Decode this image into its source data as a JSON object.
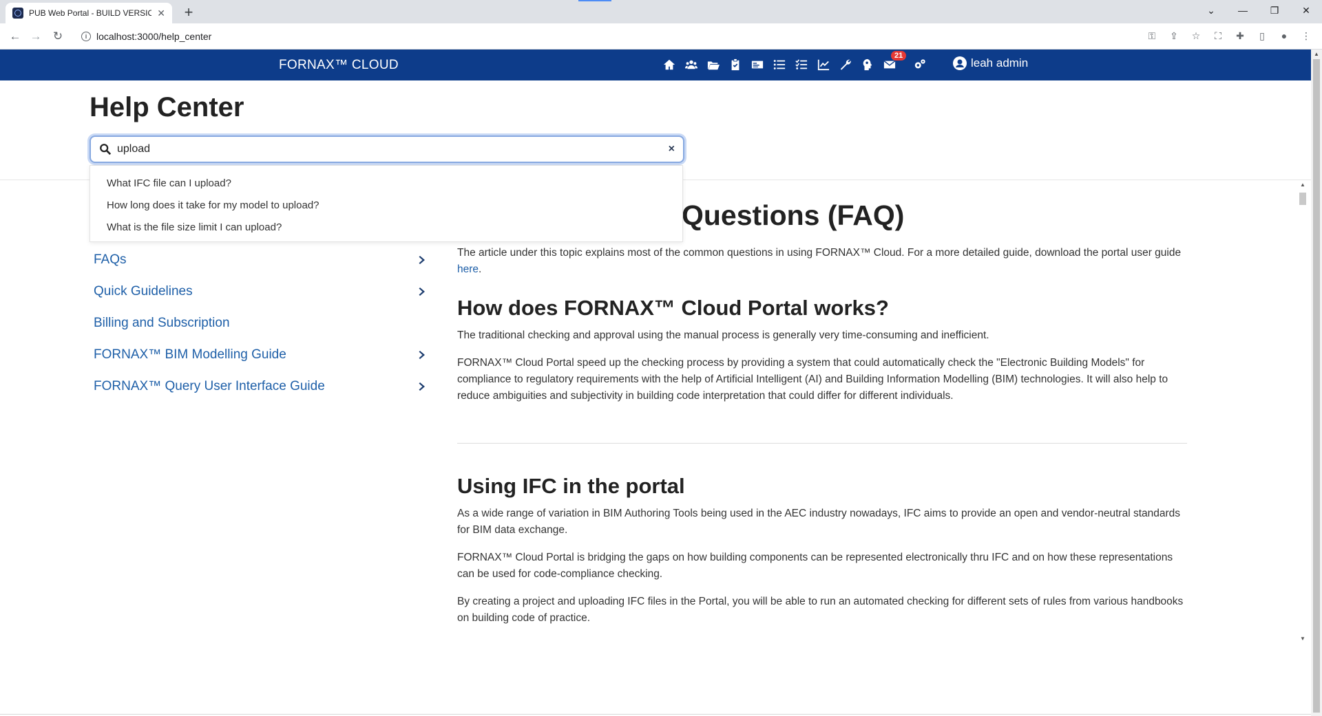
{
  "browser": {
    "tab_title": "PUB Web Portal - BUILD VERSION",
    "new_tab": "+",
    "url": "localhost:3000/help_center"
  },
  "app": {
    "brand": "FORNAX™ CLOUD",
    "notification_count": "21",
    "user_name": "leah admin"
  },
  "help": {
    "title": "Help Center",
    "search": {
      "value": "upload",
      "clear": "×"
    },
    "suggestions": [
      "What IFC file can I upload?",
      "How long does it take for my model to upload?",
      "What is the file size limit I can upload?"
    ]
  },
  "sidebar": {
    "items": [
      {
        "label": "FAQs",
        "expandable": true
      },
      {
        "label": "Quick Guidelines",
        "expandable": true
      },
      {
        "label": "Billing and Subscription",
        "expandable": false
      },
      {
        "label": "FORNAX™ BIM Modelling Guide",
        "expandable": true
      },
      {
        "label": "FORNAX™ Query User Interface Guide",
        "expandable": true
      }
    ]
  },
  "main": {
    "heading": "Questions (FAQ)",
    "intro": "The article under this topic explains most of the common questions in using FORNAX™ Cloud. For a more detailed guide, download the portal user guide ",
    "intro_link": "here",
    "intro_end": ".",
    "section1_title": "How does FORNAX™ Cloud Portal works?",
    "section1_p1": "The traditional checking and approval using the manual process is generally very time-consuming and inefficient.",
    "section1_p2": "FORNAX™ Cloud Portal speed up the checking process by providing a system that could automatically check the \"Electronic Building Models\" for compliance to regulatory requirements with the help of Artificial Intelligent (AI) and Building Information Modelling (BIM) technologies. It will also help to reduce ambiguities and subjectivity in building code interpretation that could differ for different individuals.",
    "section2_title": "Using IFC in the portal",
    "section2_p1": "As a wide range of variation in BIM Authoring Tools being used in the AEC industry nowadays, IFC aims to provide an open and vendor-neutral standards for BIM data exchange.",
    "section2_p2": "FORNAX™ Cloud Portal is bridging the gaps on how building components can be represented electronically thru IFC and on how these representations can be used for code-compliance checking.",
    "section2_p3": "By creating a project and uploading IFC files in the Portal, you will be able to run an automated checking for different sets of rules from various handbooks on building code of practice."
  }
}
